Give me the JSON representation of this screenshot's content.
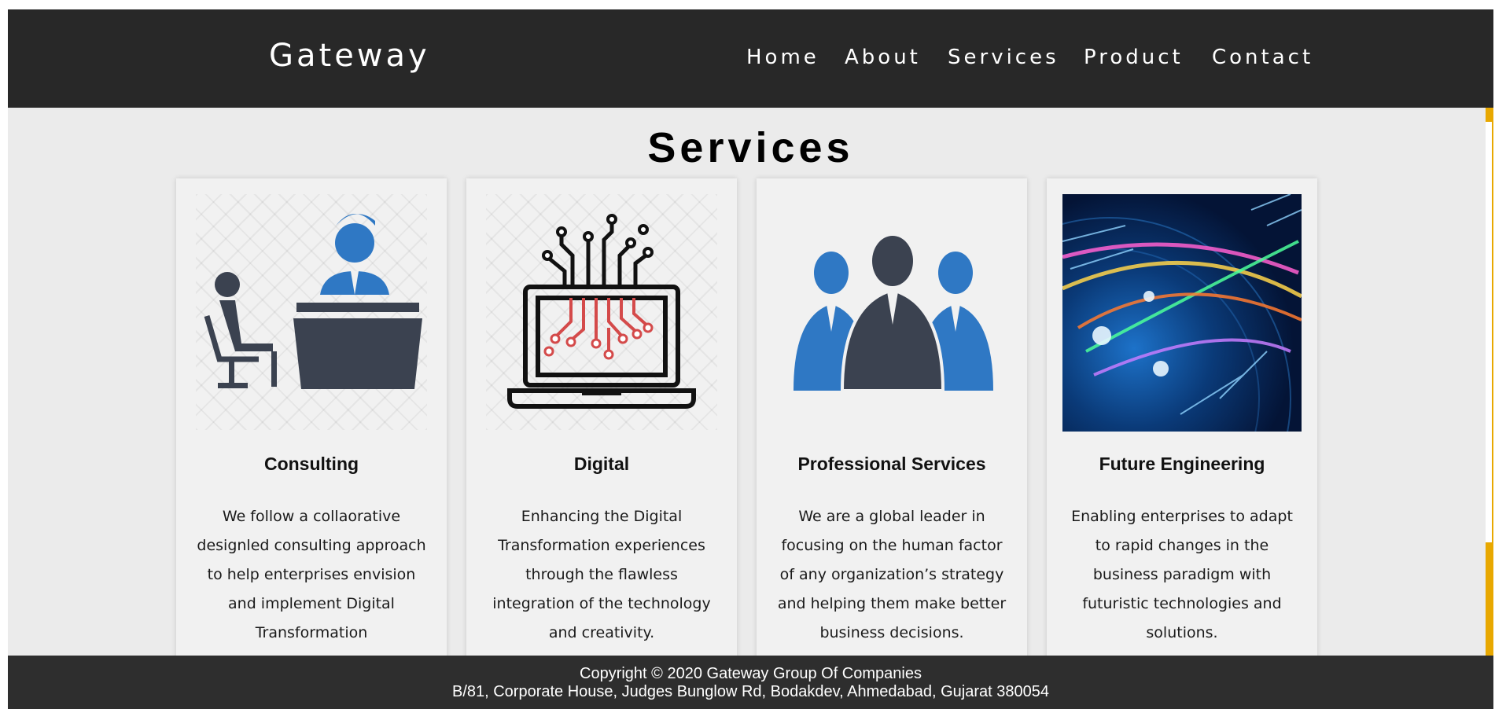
{
  "nav": {
    "brand": "Gateway",
    "links": [
      "Home",
      "About",
      "Services",
      "Product",
      "Contact"
    ]
  },
  "section": {
    "title": "Services"
  },
  "cards": [
    {
      "title": "Consulting",
      "text": "We follow a collaorative designled consulting approach to help enterprises envision and implement Digital Transformation",
      "icon": "consulting-icon"
    },
    {
      "title": "Digital",
      "text": "Enhancing the Digital Transformation experiences through the flawless integration of the technology and creativity.",
      "icon": "laptop-circuit-icon"
    },
    {
      "title": "Professional Services",
      "text": "We are a global leader in focusing on the human factor of any organization’s strategy and helping them make better business decisions.",
      "icon": "team-icon"
    },
    {
      "title": "Future Engineering",
      "text": "Enabling enterprises to adapt to rapid changes in the business paradigm with futuristic technologies and solutions.",
      "icon": "globe-network-image"
    }
  ],
  "footer": {
    "copyright": "Copyright © 2020 Gateway Group Of Companies",
    "address": "B/81, Corporate House, Judges Bunglow Rd, Bodakdev, Ahmedabad, Gujarat 380054"
  },
  "colors": {
    "navbar": "#282828",
    "page": "#ebebeb",
    "card": "#f1f1f1",
    "accent_blue": "#2f78c4",
    "dark_icon": "#3b4250",
    "circuit_red": "#d44a4a",
    "scrollbar": "#e8a800"
  }
}
